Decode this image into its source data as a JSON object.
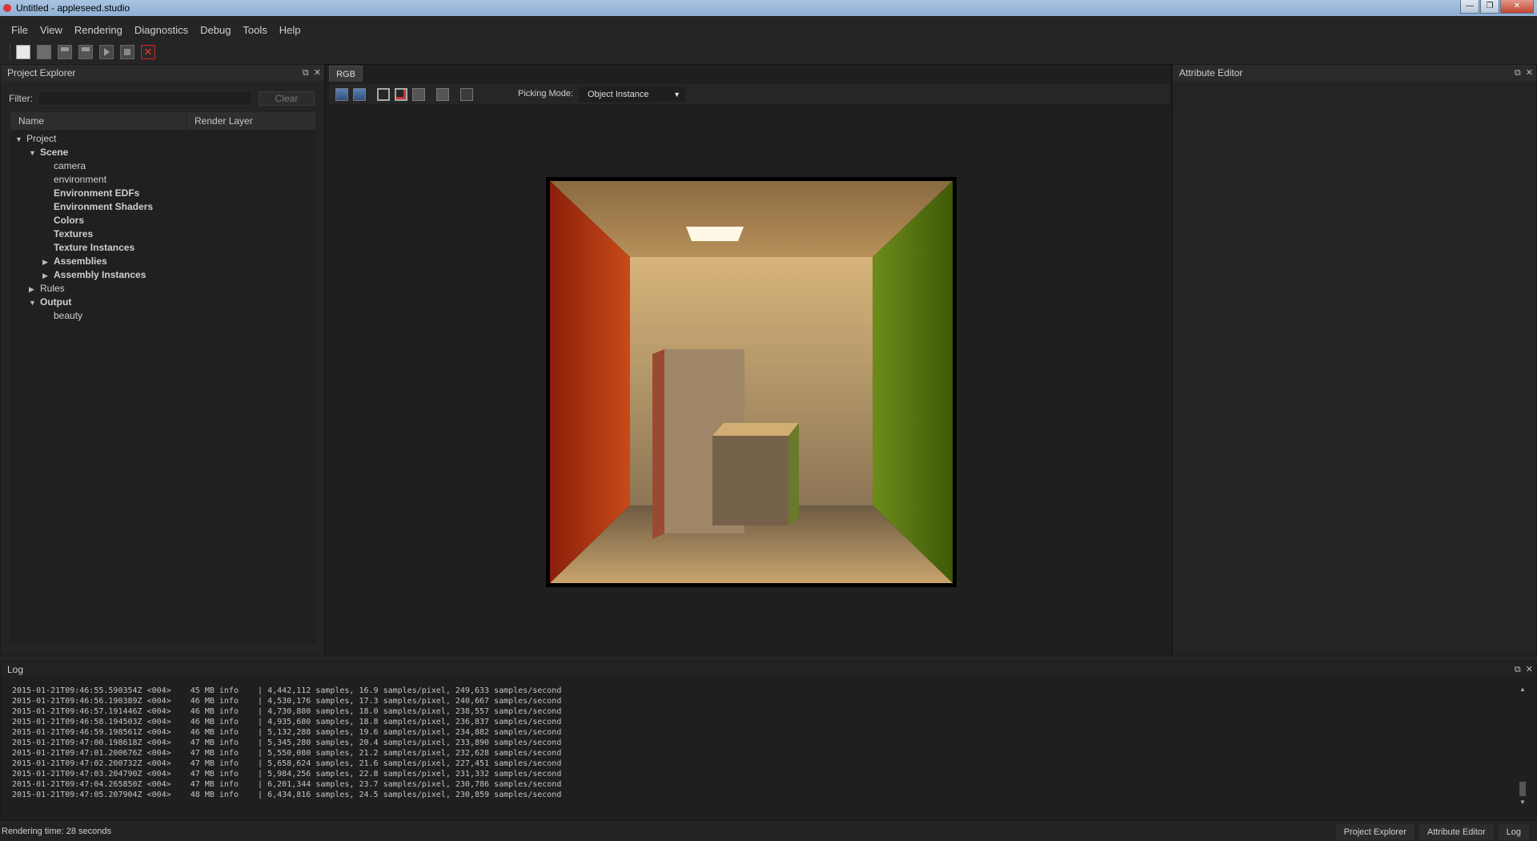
{
  "window": {
    "title": "Untitled - appleseed.studio"
  },
  "menu": [
    "File",
    "View",
    "Rendering",
    "Diagnostics",
    "Debug",
    "Tools",
    "Help"
  ],
  "explorer": {
    "title": "Project Explorer",
    "filter_label": "Filter:",
    "filter_value": "",
    "clear_label": "Clear",
    "columns": [
      "Name",
      "Render Layer"
    ],
    "tree": [
      {
        "label": "Project",
        "caret": "▼",
        "depth": 0,
        "bold": false
      },
      {
        "label": "Scene",
        "caret": "▼",
        "depth": 1,
        "bold": true
      },
      {
        "label": "camera",
        "caret": "",
        "depth": 2,
        "bold": false
      },
      {
        "label": "environment",
        "caret": "",
        "depth": 2,
        "bold": false
      },
      {
        "label": "Environment EDFs",
        "caret": "",
        "depth": 2,
        "bold": true
      },
      {
        "label": "Environment Shaders",
        "caret": "",
        "depth": 2,
        "bold": true
      },
      {
        "label": "Colors",
        "caret": "",
        "depth": 2,
        "bold": true
      },
      {
        "label": "Textures",
        "caret": "",
        "depth": 2,
        "bold": true
      },
      {
        "label": "Texture Instances",
        "caret": "",
        "depth": 2,
        "bold": true
      },
      {
        "label": "Assemblies",
        "caret": "▶",
        "depth": 2,
        "bold": true
      },
      {
        "label": "Assembly Instances",
        "caret": "▶",
        "depth": 2,
        "bold": true
      },
      {
        "label": "Rules",
        "caret": "▶",
        "depth": 1,
        "bold": false
      },
      {
        "label": "Output",
        "caret": "▼",
        "depth": 1,
        "bold": true
      },
      {
        "label": "beauty",
        "caret": "",
        "depth": 2,
        "bold": false
      }
    ]
  },
  "viewport": {
    "tab": "RGB",
    "picking_label": "Picking Mode:",
    "picking_value": "Object Instance"
  },
  "attribute_editor": {
    "title": "Attribute Editor"
  },
  "log": {
    "title": "Log",
    "lines": [
      "2015-01-21T09:46:55.590354Z <004>    45 MB info    | 4,442,112 samples, 16.9 samples/pixel, 249,633 samples/second",
      "2015-01-21T09:46:56.190389Z <004>    46 MB info    | 4,530,176 samples, 17.3 samples/pixel, 240,667 samples/second",
      "2015-01-21T09:46:57.191446Z <004>    46 MB info    | 4,730,880 samples, 18.0 samples/pixel, 238,557 samples/second",
      "2015-01-21T09:46:58.194503Z <004>    46 MB info    | 4,935,680 samples, 18.8 samples/pixel, 236,837 samples/second",
      "2015-01-21T09:46:59.198561Z <004>    46 MB info    | 5,132,288 samples, 19.6 samples/pixel, 234,882 samples/second",
      "2015-01-21T09:47:00.198618Z <004>    47 MB info    | 5,345,280 samples, 20.4 samples/pixel, 233,890 samples/second",
      "2015-01-21T09:47:01.200676Z <004>    47 MB info    | 5,550,080 samples, 21.2 samples/pixel, 232,628 samples/second",
      "2015-01-21T09:47:02.200732Z <004>    47 MB info    | 5,658,624 samples, 21.6 samples/pixel, 227,451 samples/second",
      "2015-01-21T09:47:03.204790Z <004>    47 MB info    | 5,984,256 samples, 22.8 samples/pixel, 231,332 samples/second",
      "2015-01-21T09:47:04.265850Z <004>    47 MB info    | 6,201,344 samples, 23.7 samples/pixel, 230,786 samples/second",
      "2015-01-21T09:47:05.207904Z <004>    48 MB info    | 6,434,816 samples, 24.5 samples/pixel, 230,859 samples/second"
    ]
  },
  "status": {
    "text": "Rendering time: 28 seconds",
    "tabs": [
      "Project Explorer",
      "Attribute Editor",
      "Log"
    ]
  },
  "icons": {
    "toolbar": [
      "new-project-icon",
      "open-project-icon",
      "save-project-icon",
      "reload-project-icon",
      "start-render-icon",
      "stop-render-icon",
      "close-icon"
    ],
    "viewport": [
      "save-frame-icon",
      "save-all-frames-icon",
      "set-render-region-icon",
      "clear-render-region-icon",
      "frame-icon",
      "render-settings-icon",
      "picking-icon"
    ]
  }
}
